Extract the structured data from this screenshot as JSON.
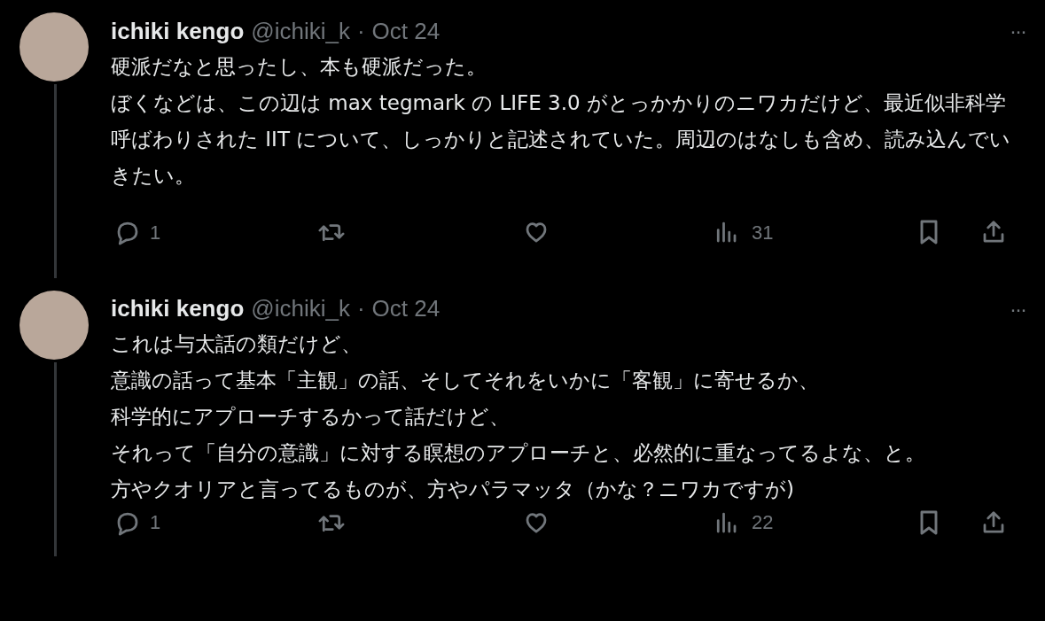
{
  "tweets": [
    {
      "name": "ichiki kengo",
      "handle": "@ichiki_k",
      "separator": "·",
      "date": "Oct 24",
      "more": "···",
      "lines": [
        "硬派だなと思ったし、本も硬派だった。",
        "ぼくなどは、この辺は max tegmark の LIFE 3.0 がとっかかりのニワカだけど、最近似非科学呼ばわりされた IIT について、しっかりと記述されていた。周辺のはなしも含め、読み込んでいきたい。"
      ],
      "replies": "1",
      "views": "31",
      "thread_continues": true
    },
    {
      "name": "ichiki kengo",
      "handle": "@ichiki_k",
      "separator": "·",
      "date": "Oct 24",
      "more": "···",
      "lines": [
        "これは与太話の類だけど、",
        "意識の話って基本「主観」の話、そしてそれをいかに「客観」に寄せるか、",
        "科学的にアプローチするかって話だけど、",
        "それって「自分の意識」に対する瞑想のアプローチと、必然的に重なってるよな、と。",
        "方やクオリアと言ってるものが、方やパラマッタ（かな？ニワカですが)"
      ],
      "replies": "1",
      "views": "22",
      "thread_continues": true
    }
  ]
}
